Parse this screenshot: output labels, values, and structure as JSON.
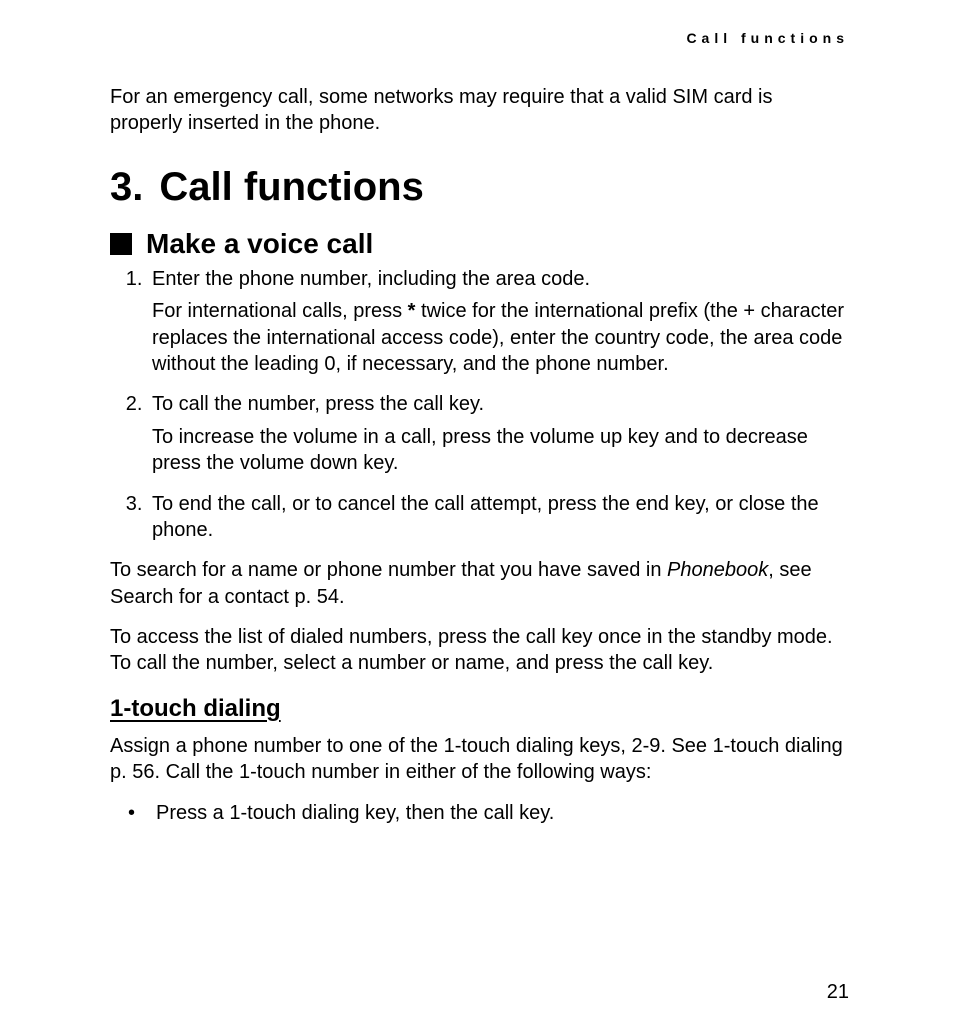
{
  "header": {
    "running_title": "Call functions"
  },
  "intro": {
    "text": "For an emergency call, some networks may require that a valid SIM card is properly inserted in the phone."
  },
  "chapter": {
    "number": "3.",
    "title": "Call functions"
  },
  "section": {
    "title": "Make a voice call"
  },
  "steps": [
    {
      "main": "Enter the phone number, including the area code.",
      "extra_before": "For international calls, press ",
      "extra_bold": "*",
      "extra_after": " twice for the international prefix (the + character replaces the international access code), enter the country code, the area code without the leading 0, if necessary, and the phone number."
    },
    {
      "main": "To call the number, press the call key.",
      "extra": "To increase the volume in a call, press the volume up key and to decrease press the volume down key."
    },
    {
      "main": "To end the call, or to cancel the call attempt, press the end key, or close the phone."
    }
  ],
  "after_steps": {
    "p1_before": "To search for a name or phone number that you have saved in ",
    "p1_italic": "Phonebook",
    "p1_after": ", see Search for a contact p. 54.",
    "p2": "To access the list of dialed numbers, press the call key once in the standby mode. To call the number, select a number or name, and press the call key."
  },
  "subsection": {
    "title": "1-touch dialing",
    "intro": "Assign a phone number to one of the 1-touch dialing keys, 2-9. See 1-touch dialing p. 56. Call the 1-touch number in either of the following ways:",
    "bullets": [
      "Press a 1-touch dialing key, then the call key."
    ]
  },
  "page_number": "21"
}
